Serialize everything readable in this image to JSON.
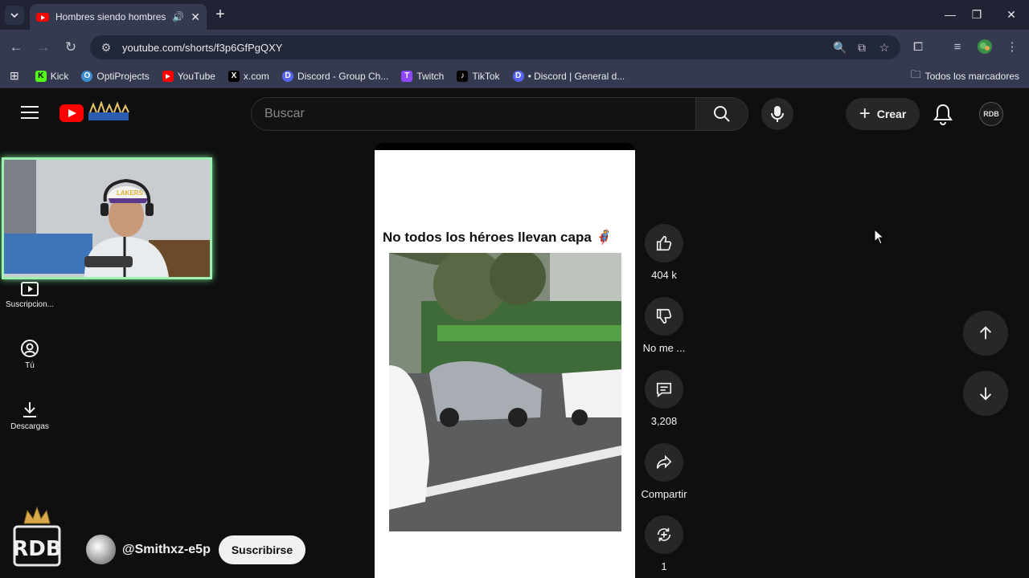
{
  "browser": {
    "tab_title": "Hombres siendo hombres #",
    "url": "youtube.com/shorts/f3p6GfPgQXY",
    "bookmarks": [
      {
        "label": "Kick",
        "color": "#53fc18",
        "glyph": "K"
      },
      {
        "label": "OptiProjects",
        "color": "#3b8ed0",
        "glyph": "O"
      },
      {
        "label": "YouTube",
        "color": "#ff0000",
        "glyph": "▶"
      },
      {
        "label": "x.com",
        "color": "#000000",
        "glyph": "X"
      },
      {
        "label": "Discord - Group Ch...",
        "color": "#5865f2",
        "glyph": "D"
      },
      {
        "label": "Twitch",
        "color": "#9146ff",
        "glyph": "T"
      },
      {
        "label": "TikTok",
        "color": "#000000",
        "glyph": "♪"
      },
      {
        "label": "• Discord | General d...",
        "color": "#5865f2",
        "glyph": "D"
      }
    ],
    "all_bookmarks_label": "Todos los marcadores"
  },
  "header": {
    "search_placeholder": "Buscar",
    "create_label": "Crear",
    "avatar_text": "RDB"
  },
  "sidebar": {
    "items": [
      {
        "label": "Suscripcion..."
      },
      {
        "label": "Tú"
      },
      {
        "label": "Descargas"
      }
    ]
  },
  "short": {
    "caption": "No todos los héroes llevan capa 🦸",
    "likes": "404 k",
    "dislike_label": "No me ...",
    "comments": "3,208",
    "share_label": "Compartir",
    "remix_count": "1",
    "channel_handle": "@Smithxz-e5p",
    "subscribe_label": "Suscribirse"
  },
  "overlay": {
    "logo_text": "RDB"
  },
  "colors": {
    "accent": "#ff0000",
    "webcam_border": "#9ef0b0"
  }
}
